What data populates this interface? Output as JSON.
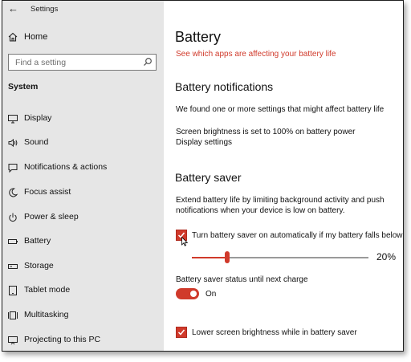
{
  "window": {
    "title": "Settings"
  },
  "sidebar": {
    "home_label": "Home",
    "search_placeholder": "Find a setting",
    "section_label": "System",
    "items": [
      {
        "label": "Display",
        "icon": "monitor-icon"
      },
      {
        "label": "Sound",
        "icon": "speaker-icon"
      },
      {
        "label": "Notifications & actions",
        "icon": "notifications-icon"
      },
      {
        "label": "Focus assist",
        "icon": "moon-icon"
      },
      {
        "label": "Power & sleep",
        "icon": "power-icon"
      },
      {
        "label": "Battery",
        "icon": "battery-icon"
      },
      {
        "label": "Storage",
        "icon": "storage-icon"
      },
      {
        "label": "Tablet mode",
        "icon": "tablet-icon"
      },
      {
        "label": "Multitasking",
        "icon": "multitasking-icon"
      },
      {
        "label": "Projecting to this PC",
        "icon": "projector-icon"
      }
    ]
  },
  "main": {
    "title": "Battery",
    "see_apps_link": "See which apps are affecting your battery life",
    "notifications": {
      "heading": "Battery notifications",
      "text": "We found one or more settings that might affect battery life",
      "brightness_text": "Screen brightness is set to 100% on battery power",
      "display_link": "Display settings"
    },
    "saver": {
      "heading": "Battery saver",
      "description": "Extend battery life by limiting background activity and push notifications when your device is low on battery.",
      "auto_label": "Turn battery saver on automatically if my battery falls below:",
      "auto_checked": true,
      "threshold_percent": 20,
      "threshold_text": "20%",
      "status_label": "Battery saver status until next charge",
      "toggle_on": true,
      "toggle_state_text": "On",
      "lower_brightness_label": "Lower screen brightness while in battery saver",
      "lower_brightness_checked": true
    }
  },
  "colors": {
    "accent": "#d03a2b",
    "sidebar_bg": "#e6e6e6"
  }
}
